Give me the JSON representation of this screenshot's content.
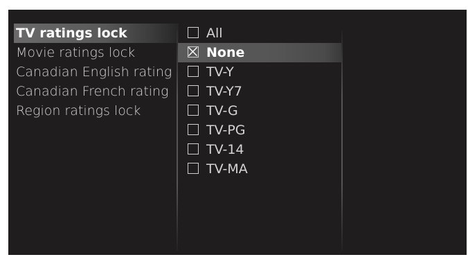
{
  "menu": {
    "items": [
      {
        "label": "TV ratings lock",
        "selected": true
      },
      {
        "label": "Movie ratings lock",
        "selected": false
      },
      {
        "label": "Canadian English rating",
        "selected": false
      },
      {
        "label": "Canadian French rating",
        "selected": false
      },
      {
        "label": "Region ratings lock",
        "selected": false
      }
    ]
  },
  "ratings": {
    "options": [
      {
        "label": "All",
        "checked": false,
        "selected": false
      },
      {
        "label": "None",
        "checked": true,
        "selected": true
      },
      {
        "label": "TV-Y",
        "checked": false,
        "selected": false
      },
      {
        "label": "TV-Y7",
        "checked": false,
        "selected": false
      },
      {
        "label": "TV-G",
        "checked": false,
        "selected": false
      },
      {
        "label": "TV-PG",
        "checked": false,
        "selected": false
      },
      {
        "label": "TV-14",
        "checked": false,
        "selected": false
      },
      {
        "label": "TV-MA",
        "checked": false,
        "selected": false
      }
    ]
  }
}
